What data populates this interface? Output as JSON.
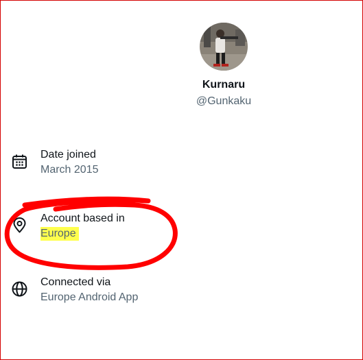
{
  "profile": {
    "display_name": "Kurnaru",
    "handle": "@Gunkaku"
  },
  "details": [
    {
      "label": "Date joined",
      "value": "March 2015",
      "icon": "calendar-icon"
    },
    {
      "label": "Account based in",
      "value": "Europe",
      "icon": "location-pin-icon"
    },
    {
      "label": "Connected via",
      "value": "Europe Android App",
      "icon": "globe-icon"
    }
  ],
  "colors": {
    "primary_text": "#0f1419",
    "secondary_text": "#536471",
    "frame_border": "#d40000",
    "annotation_circle": "#ff0000",
    "highlight": "#ffff4d"
  }
}
